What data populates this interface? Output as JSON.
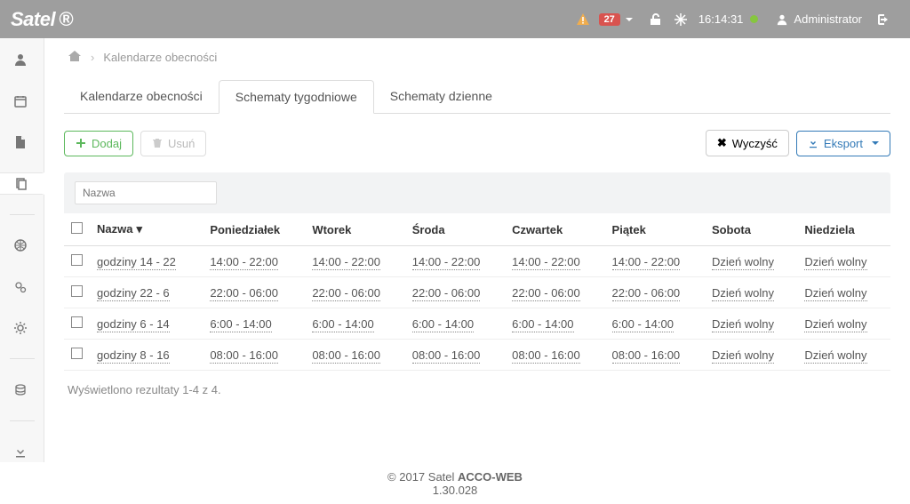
{
  "header": {
    "logo_text": "Satel",
    "alert_count": "27",
    "time": "16:14:31",
    "user": "Administrator"
  },
  "breadcrumb": {
    "title": "Kalendarze obecności"
  },
  "tabs": [
    {
      "label": "Kalendarze obecności",
      "active": false
    },
    {
      "label": "Schematy tygodniowe",
      "active": true
    },
    {
      "label": "Schematy dzienne",
      "active": false
    }
  ],
  "buttons": {
    "add": "Dodaj",
    "delete": "Usuń",
    "clear": "Wyczyść",
    "export": "Eksport"
  },
  "filter": {
    "name_placeholder": "Nazwa"
  },
  "columns": {
    "name": "Nazwa",
    "mon": "Poniedziałek",
    "tue": "Wtorek",
    "wed": "Środa",
    "thu": "Czwartek",
    "fri": "Piątek",
    "sat": "Sobota",
    "sun": "Niedziela"
  },
  "free_day": "Dzień wolny",
  "rows": [
    {
      "name": "godziny 14 - 22",
      "mon": "14:00 - 22:00",
      "tue": "14:00 - 22:00",
      "wed": "14:00 - 22:00",
      "thu": "14:00 - 22:00",
      "fri": "14:00 - 22:00",
      "sat": "Dzień wolny",
      "sun": "Dzień wolny"
    },
    {
      "name": "godziny 22 - 6",
      "mon": "22:00 - 06:00",
      "tue": "22:00 - 06:00",
      "wed": "22:00 - 06:00",
      "thu": "22:00 - 06:00",
      "fri": "22:00 - 06:00",
      "sat": "Dzień wolny",
      "sun": "Dzień wolny"
    },
    {
      "name": "godziny 6 - 14",
      "mon": "6:00 - 14:00",
      "tue": "6:00 - 14:00",
      "wed": "6:00 - 14:00",
      "thu": "6:00 - 14:00",
      "fri": "6:00 - 14:00",
      "sat": "Dzień wolny",
      "sun": "Dzień wolny"
    },
    {
      "name": "godziny 8 - 16",
      "mon": "08:00 - 16:00",
      "tue": "08:00 - 16:00",
      "wed": "08:00 - 16:00",
      "thu": "08:00 - 16:00",
      "fri": "08:00 - 16:00",
      "sat": "Dzień wolny",
      "sun": "Dzień wolny"
    }
  ],
  "summary": "Wyświetlono rezultaty 1-4 z 4.",
  "footer": {
    "line1_prefix": "© 2017 Satel ",
    "line1_bold": "ACCO-WEB",
    "version": "1.30.028"
  }
}
